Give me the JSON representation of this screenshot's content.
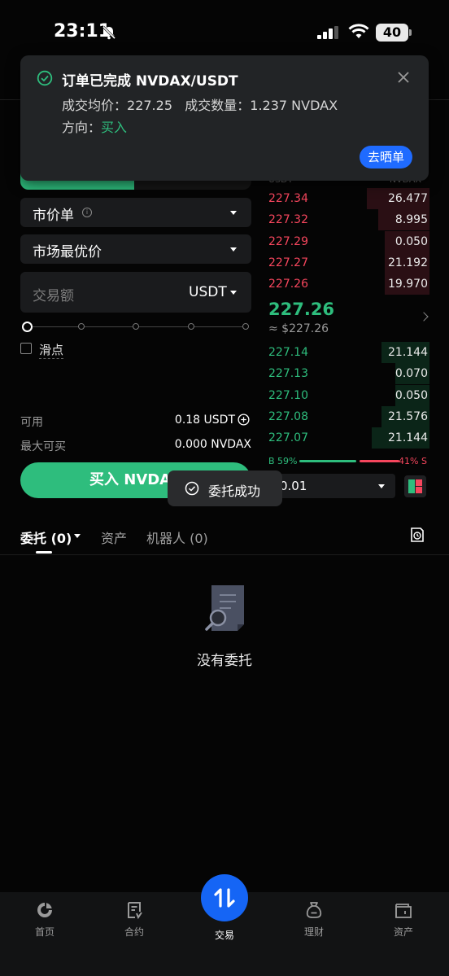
{
  "status_bar": {
    "time": "23:11",
    "battery": "40"
  },
  "notification": {
    "title": "订单已完成 NVDAX/USDT",
    "avg_price_label": "成交均价：",
    "avg_price": "227.25",
    "qty_label": "成交数量：",
    "qty": "1.237 NVDAX",
    "direction_label": "方向：",
    "direction": "买入",
    "share_button": "去晒单"
  },
  "form": {
    "order_type": "市价单",
    "price_mode": "市场最优价",
    "amount_placeholder": "交易额",
    "amount_unit": "USDT",
    "slippage_label": "滑点",
    "available_label": "可用",
    "available_value": "0.18 USDT",
    "max_buy_label": "最大可买",
    "max_buy_value": "0.000 NVDAX",
    "buy_button": "买入 NVDAX"
  },
  "order_book": {
    "header_price": "USDT",
    "header_qty": "NVDAX",
    "asks": [
      {
        "price": "227.34",
        "qty": "26.477",
        "depth": 0.39
      },
      {
        "price": "227.32",
        "qty": "8.995",
        "depth": 0.32
      },
      {
        "price": "227.29",
        "qty": "0.050",
        "depth": 0.28
      },
      {
        "price": "227.27",
        "qty": "21.192",
        "depth": 0.28
      },
      {
        "price": "227.26",
        "qty": "19.970",
        "depth": 0.28
      }
    ],
    "mid_price": "227.26",
    "mid_fiat": "≈ $227.26",
    "bids": [
      {
        "price": "227.14",
        "qty": "21.144",
        "depth": 0.3
      },
      {
        "price": "227.13",
        "qty": "0.070",
        "depth": 0.21
      },
      {
        "price": "227.10",
        "qty": "0.050",
        "depth": 0.21
      },
      {
        "price": "227.08",
        "qty": "21.576",
        "depth": 0.3
      },
      {
        "price": "227.07",
        "qty": "21.144",
        "depth": 0.36
      }
    ],
    "buy_ratio_label": "B 59%",
    "sell_ratio_label": "41% S",
    "buy_ratio": 0.59,
    "depth_precision": "0.01"
  },
  "toast": {
    "text": "委托成功"
  },
  "tabs": {
    "orders": "委托 (0)",
    "assets": "资产",
    "bots": "机器人 (0)"
  },
  "empty_state": {
    "text": "没有委托"
  },
  "bottom_nav": {
    "home": "首页",
    "futures": "合约",
    "trade": "交易",
    "earn": "理财",
    "assets": "资产"
  },
  "colors": {
    "buy": "#2ebd7d",
    "sell": "#f6465d",
    "accent": "#1f6bff"
  }
}
